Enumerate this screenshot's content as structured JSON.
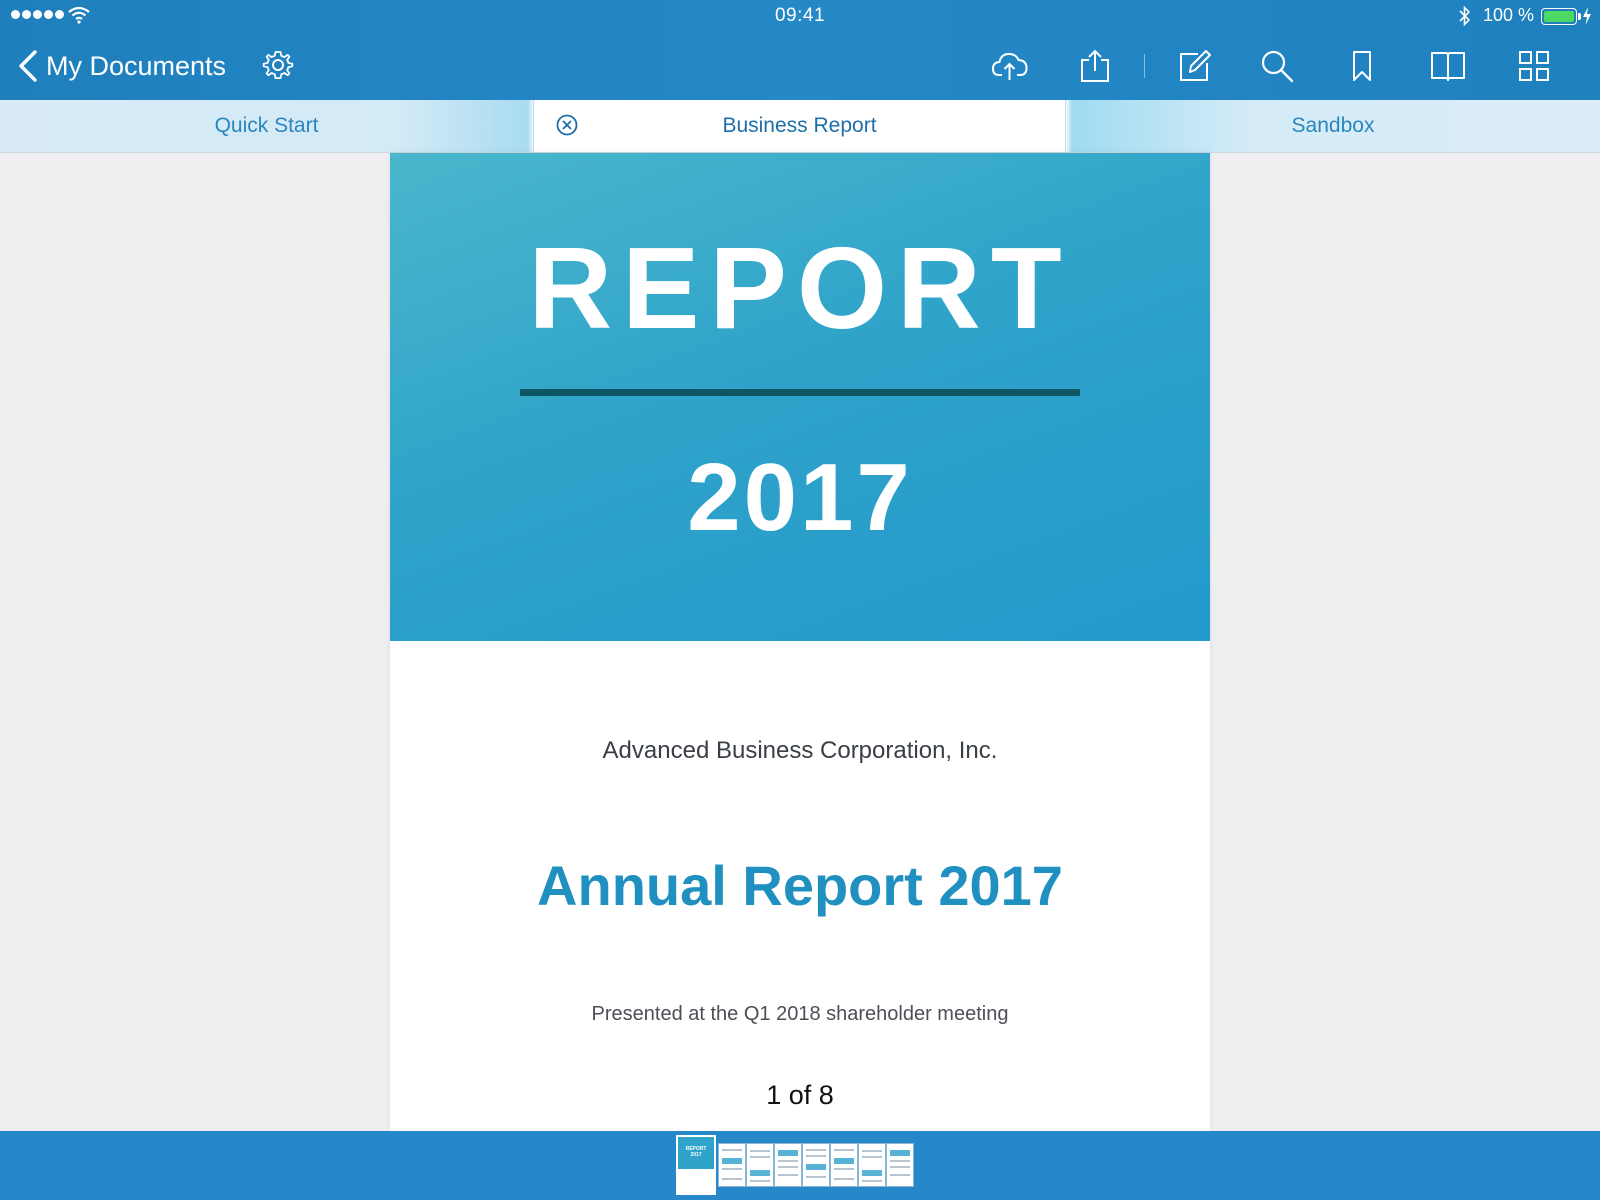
{
  "status_bar": {
    "time": "09:41",
    "battery_percent": "100 %",
    "battery_level": 1.0,
    "icons": [
      "signal-dots-icon",
      "wifi-icon",
      "bluetooth-icon",
      "battery-icon",
      "charging-bolt-icon"
    ]
  },
  "nav": {
    "back_label": "My Documents",
    "icons": [
      "chevron-left-icon",
      "gear-icon",
      "cloud-upload-icon",
      "share-icon",
      "edit-icon",
      "search-icon",
      "bookmark-icon",
      "book-icon",
      "grid-icon"
    ]
  },
  "tabs": [
    {
      "label": "Quick Start",
      "active": false
    },
    {
      "label": "Business Report",
      "active": true
    },
    {
      "label": "Sandbox",
      "active": false
    }
  ],
  "document": {
    "cover_title": "REPORT",
    "cover_year": "2017",
    "company": "Advanced Business Corporation, Inc.",
    "heading": "Annual Report 2017",
    "subtitle": "Presented at the Q1 2018 shareholder meeting"
  },
  "pager": {
    "current": 1,
    "total": 8,
    "indicator": "1 of 8"
  },
  "thumbnails": {
    "count": 8,
    "selected": 1,
    "first_cover_title": "REPORT",
    "first_cover_year": "2017"
  },
  "colors": {
    "bar_blue": "#2688c8",
    "accent": "#2090c0",
    "cover_teal": "#2fa3c9",
    "rule": "#0e5664"
  }
}
